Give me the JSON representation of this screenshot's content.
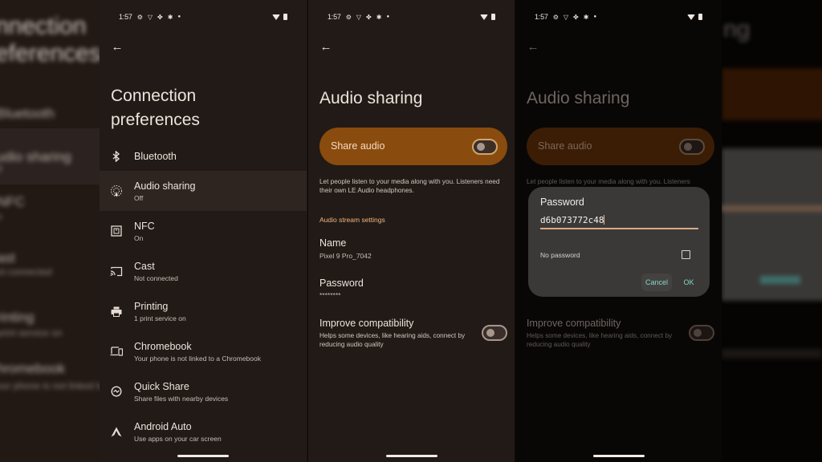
{
  "status_bar": {
    "time": "1:57",
    "icons": [
      "settings-icon",
      "vpn-shield-icon",
      "fan-icon",
      "snowflake-icon",
      "notification-dot-icon"
    ],
    "right_icons": [
      "wifi-icon",
      "battery-icon"
    ]
  },
  "screen1": {
    "title_line1": "Connection",
    "title_line2": "preferences",
    "items": [
      {
        "icon": "bluetooth-icon",
        "title": "Bluetooth",
        "subtitle": ""
      },
      {
        "icon": "audio-sharing-icon",
        "title": "Audio sharing",
        "subtitle": "Off"
      },
      {
        "icon": "nfc-icon",
        "title": "NFC",
        "subtitle": "On"
      },
      {
        "icon": "cast-icon",
        "title": "Cast",
        "subtitle": "Not connected"
      },
      {
        "icon": "printer-icon",
        "title": "Printing",
        "subtitle": "1 print service on"
      },
      {
        "icon": "chromebook-icon",
        "title": "Chromebook",
        "subtitle": "Your phone is not linked to a Chromebook"
      },
      {
        "icon": "quick-share-icon",
        "title": "Quick Share",
        "subtitle": "Share files with nearby devices"
      },
      {
        "icon": "android-auto-icon",
        "title": "Android Auto",
        "subtitle": "Use apps on your car screen"
      }
    ]
  },
  "screen2": {
    "title": "Audio sharing",
    "share_audio_label": "Share audio",
    "share_audio_on": false,
    "description": "Let people listen to your media along with you. Listeners need their own LE Audio headphones.",
    "section_header": "Audio stream settings",
    "name_label": "Name",
    "name_value": "Pixel 9 Pro_7042",
    "password_label": "Password",
    "password_value": "********",
    "improve_label": "Improve compatibility",
    "improve_desc": "Helps some devices, like hearing aids, connect by reducing audio quality",
    "improve_on": false
  },
  "screen3": {
    "title": "Audio sharing",
    "share_audio_label": "Share audio",
    "description_line1": "Let people listen to your media along with you. Listeners",
    "improve_label": "Improve compatibility",
    "improve_desc": "Helps some devices, like hearing aids, connect by reducing audio quality",
    "dialog": {
      "title": "Password",
      "input_value": "d6b073772c48",
      "no_password_label": "No password",
      "no_password_checked": false,
      "cancel_label": "Cancel",
      "ok_label": "OK"
    }
  },
  "side_left": {
    "lines": [
      "nnection",
      "eferences",
      "Bluetooth",
      "udio sharing",
      "ff",
      "NFC",
      "n",
      "ast",
      "ot connected",
      "rinting",
      "print service on",
      "hromebook",
      "our phone is not linked to a Chromebook"
    ]
  },
  "side_right": {
    "lines": [
      "ng"
    ]
  }
}
